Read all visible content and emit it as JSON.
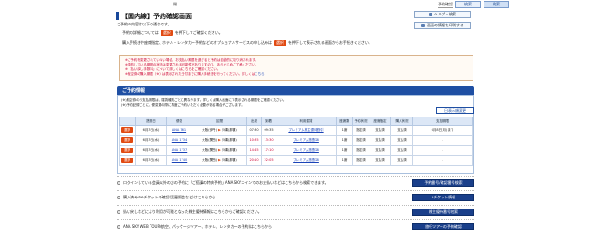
{
  "header": {
    "mark": "閉",
    "mypage_label": "予約確認",
    "tab_search": "検索",
    "tab_search2": "検索"
  },
  "page": {
    "title": "【国内線】予約確認画面",
    "subtitle": "ご予約の内容は以下の通りです。",
    "help_button": "ヘルプ・検索",
    "info_button": "画面の情報を印刷する",
    "line1_prefix": "予約の詳細については",
    "line1_suffix": "を押下してご確認ください。",
    "line2_prefix": "購入手続きや座席指定、ホテル・レンタカー予約などのオプショナルサービスの申し込みは",
    "line2_suffix": "を押下して表示される画面からお手続きください。",
    "cancel_label": "選択"
  },
  "notice": {
    "line1": "※ご予約を変更されていない場合、お支払い期限を過ぎると予約は自動的に取り消されます。",
    "line2": "※運航している期間の状況は変更される可能性がありますので、あらかじめご了承ください。",
    "line3": "※「払い戻し手数料」について詳しくはこちらをご確認ください。",
    "line4_prefix": "※航空券の購入期限（※）は表示された日付までに購入手続きを行ってください。詳しくは",
    "line4_link": "こちら"
  },
  "reservation": {
    "section_title": "ご予約情報",
    "note1": "(※)航空券のお支払期限は、運賃種別ごとに異なります。詳しくは購入画面にて表示される期限をご確認ください。",
    "note2": "(※)予約記録ごとに、便変更の際に再度ご予約いただく必要がある場合がございます。",
    "show_button": "日表示順変更",
    "columns": [
      "",
      "搭乗日",
      "便名",
      "区間",
      "出発",
      "到着",
      "利用運賃",
      "座席数",
      "予約状況",
      "座席指定",
      "購入状況",
      "支払期限"
    ],
    "rows": [
      {
        "select": "選択",
        "date": "6月3日(水)",
        "flight": "ANA 761",
        "from": "大阪(伊丹)",
        "to": "沖縄(那覇)",
        "dep": "07:30",
        "arr": "09:35",
        "fare": "プレミアム株主優待割引",
        "seats": "1席",
        "status": "指定済",
        "seat": "支払済",
        "purchase": "支払済",
        "deadline": "6月8日(月)まで"
      },
      {
        "select": "選択",
        "date": "6月3日(水)",
        "flight": "ANA 1734",
        "from": "大阪(関西)",
        "to": "沖縄(那覇)",
        "dep": "10:35",
        "arr": "13:30",
        "fare": "プレミアム旅割28",
        "seats": "1席",
        "status": "指定済",
        "seat": "支払済",
        "purchase": "支払済",
        "deadline": "-"
      },
      {
        "select": "選択",
        "date": "6月3日(水)",
        "flight": "ANA 1737",
        "from": "大阪(関西)",
        "to": "沖縄(那覇)",
        "dep": "14:45",
        "arr": "17:10",
        "fare": "プレミアム旅割28",
        "seats": "1席",
        "status": "指定済",
        "seat": "支払済",
        "purchase": "支払済",
        "deadline": "-"
      },
      {
        "select": "選択",
        "date": "6月3日(水)",
        "flight": "ANA 1740",
        "from": "大阪(関西)",
        "to": "沖縄(那覇)",
        "dep": "20:10",
        "arr": "22:05",
        "fare": "プレミアム旅割28",
        "seats": "1席",
        "status": "指定済",
        "seat": "支払済",
        "purchase": "支払済",
        "deadline": "-"
      }
    ]
  },
  "actions": [
    {
      "text": "ログインしている会員以外の方の予約に「ご搭乗の特典予約」ANA SKYコインでのお支払いなどはこちらから検索できます。",
      "button": "予約番号/確認番号検索"
    },
    {
      "text": "購入済みのeチケットの確認(変更照会など)はこちらから",
      "button": "eチケット情報"
    },
    {
      "text": "払い戻しなどにより利用が可能となった株主優待情報はこちらからご確認ください。",
      "button": "株主優待番号検索"
    },
    {
      "text": "ANA SKY WEB TOUR(航空、パッケージツアー、ホテル、レンタカーの予約)はこちらから",
      "button": "旅行ツアーの予約確認"
    }
  ]
}
